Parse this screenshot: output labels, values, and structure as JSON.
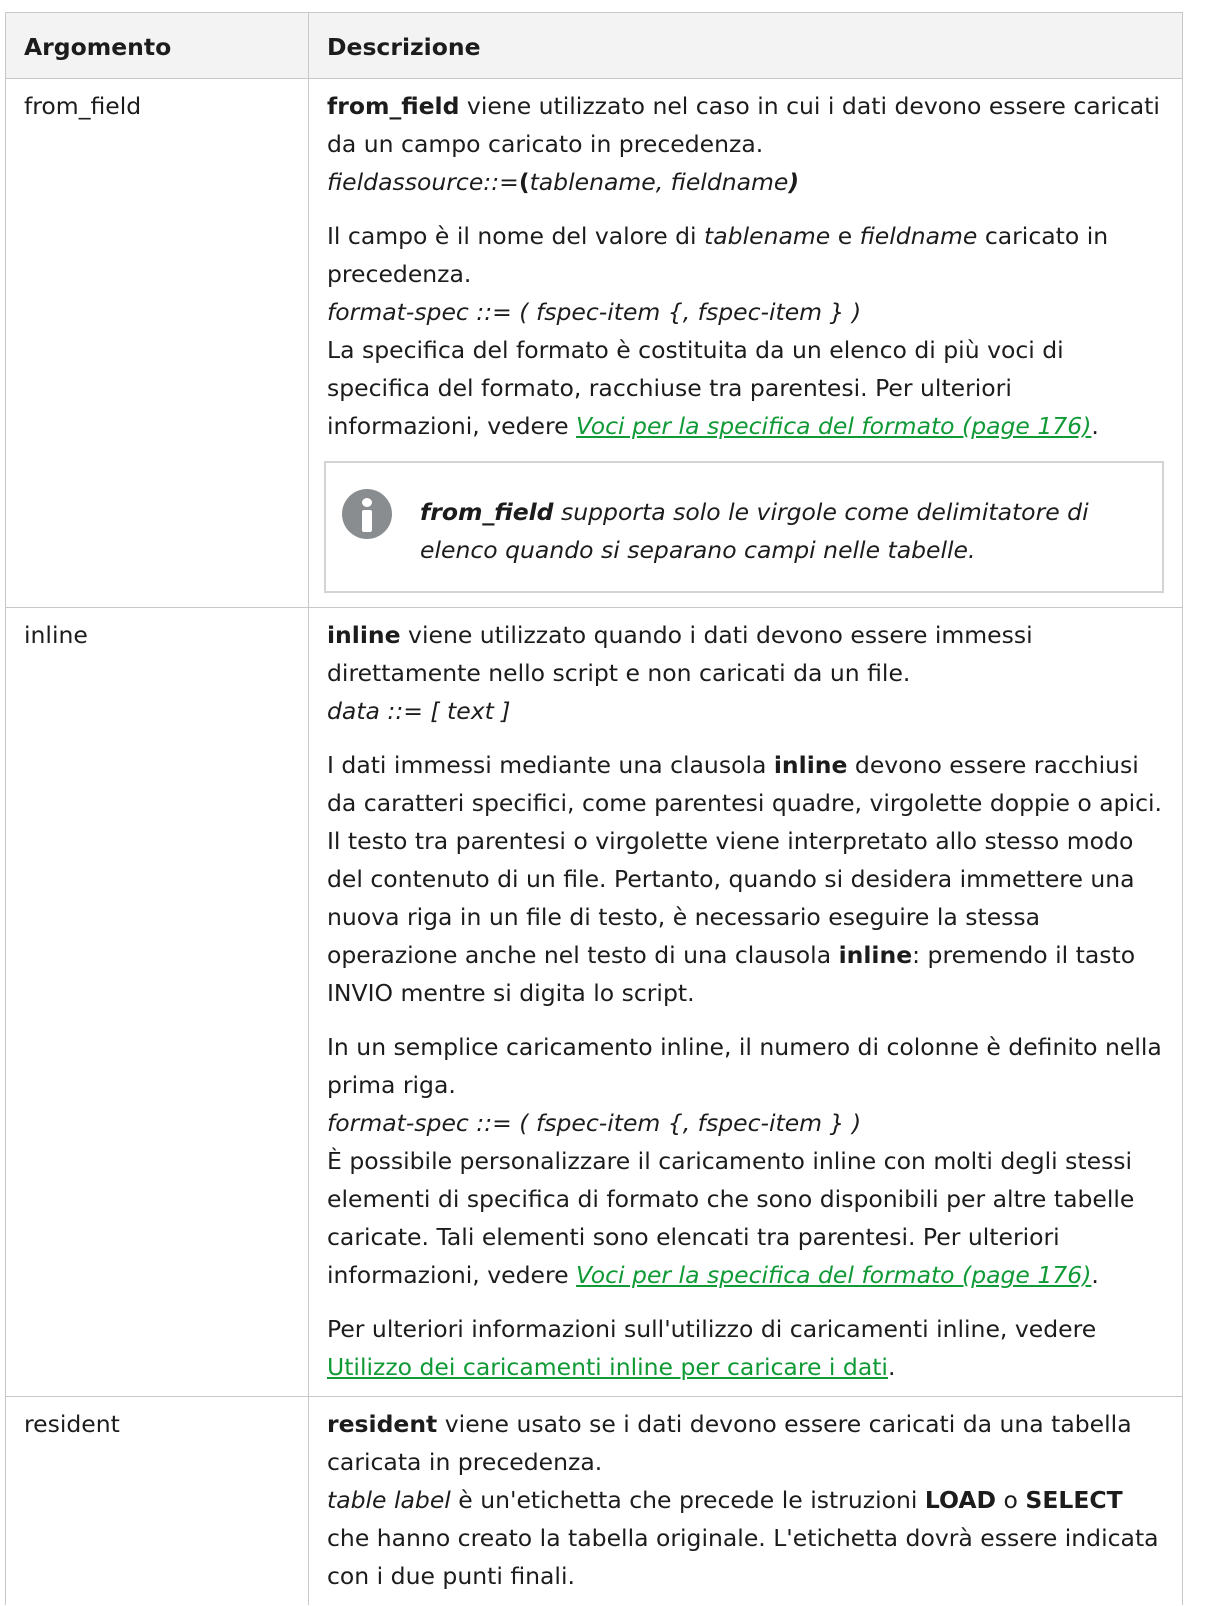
{
  "table": {
    "headers": {
      "argument": "Argomento",
      "description": "Descrizione"
    },
    "rows": {
      "from_field": {
        "arg": "from_field",
        "p1": {
          "b": "from_field",
          "t": " viene utilizzato nel caso in cui i dati devono essere caricati da un campo caricato in precedenza.",
          "syn_a": "fieldassource::=",
          "syn_b": "(",
          "syn_c": "tablename, fieldname",
          "syn_d": ")"
        },
        "p2": {
          "t1": "Il campo è il nome del valore di ",
          "i1": "tablename",
          "t2": " e ",
          "i2": "fieldname",
          "t3": " caricato in precedenza.",
          "syn": "format-spec ::= ( fspec-item {, fspec-item } )",
          "t4": "La specifica del formato è costituita da un elenco di più voci di specifica del formato, racchiuse tra parentesi. Per ulteriori informazioni, vedere ",
          "link": "Voci per la specifica del formato (page 176)",
          "t5": "."
        },
        "note": {
          "b": "from_field",
          "t": " supporta solo le virgole come delimitatore di elenco quando si separano campi nelle tabelle."
        }
      },
      "inline": {
        "arg": "inline",
        "p1": {
          "b": "inline",
          "t": " viene utilizzato quando i dati devono essere immessi direttamente nello script e non caricati da un file.",
          "syn": "data ::= [ text ]"
        },
        "p2": {
          "t1": "I dati immessi mediante una clausola ",
          "b1": "inline",
          "t2": " devono essere racchiusi da caratteri specifici, come parentesi quadre, virgolette doppie o apici. Il testo tra parentesi o virgolette viene interpretato allo stesso modo del contenuto di un file. Pertanto, quando si desidera immettere una nuova riga in un file di testo, è necessario eseguire la stessa operazione anche nel testo di una clausola ",
          "b2": "inline",
          "t3": ": premendo il tasto INVIO mentre si digita lo script."
        },
        "p3": {
          "t1": "In un semplice caricamento inline, il numero di colonne è definito nella prima riga.",
          "syn": "format-spec ::= ( fspec-item {, fspec-item } )",
          "t2": "È possibile personalizzare il caricamento inline con molti degli stessi elementi di specifica di formato che sono disponibili per altre tabelle caricate. Tali elementi sono elencati tra parentesi. Per ulteriori informazioni, vedere ",
          "link": "Voci per la specifica del formato (page 176)",
          "t3": "."
        },
        "p4": {
          "t1": "Per ulteriori informazioni sull'utilizzo di caricamenti inline, vedere ",
          "link": "Utilizzo dei caricamenti inline per caricare i dati",
          "t2": "."
        }
      },
      "resident": {
        "arg": "resident",
        "p1": {
          "b": "resident",
          "t": " viene usato se i dati devono essere caricati da una tabella caricata in precedenza.",
          "i1": "table label",
          "t2": " è un'etichetta che precede le istruzioni ",
          "b2": "LOAD",
          "t3": " o ",
          "b3": "SELECT",
          "t4": " che hanno creato la tabella originale. L'etichetta dovrà essere indicata con i due punti finali."
        }
      }
    }
  },
  "colors": {
    "link": "#109a36",
    "border": "#c8c8c8",
    "header_bg": "#f3f3f3",
    "note_icon": "#8a8d8f"
  },
  "icons": {
    "note": "info-icon"
  }
}
